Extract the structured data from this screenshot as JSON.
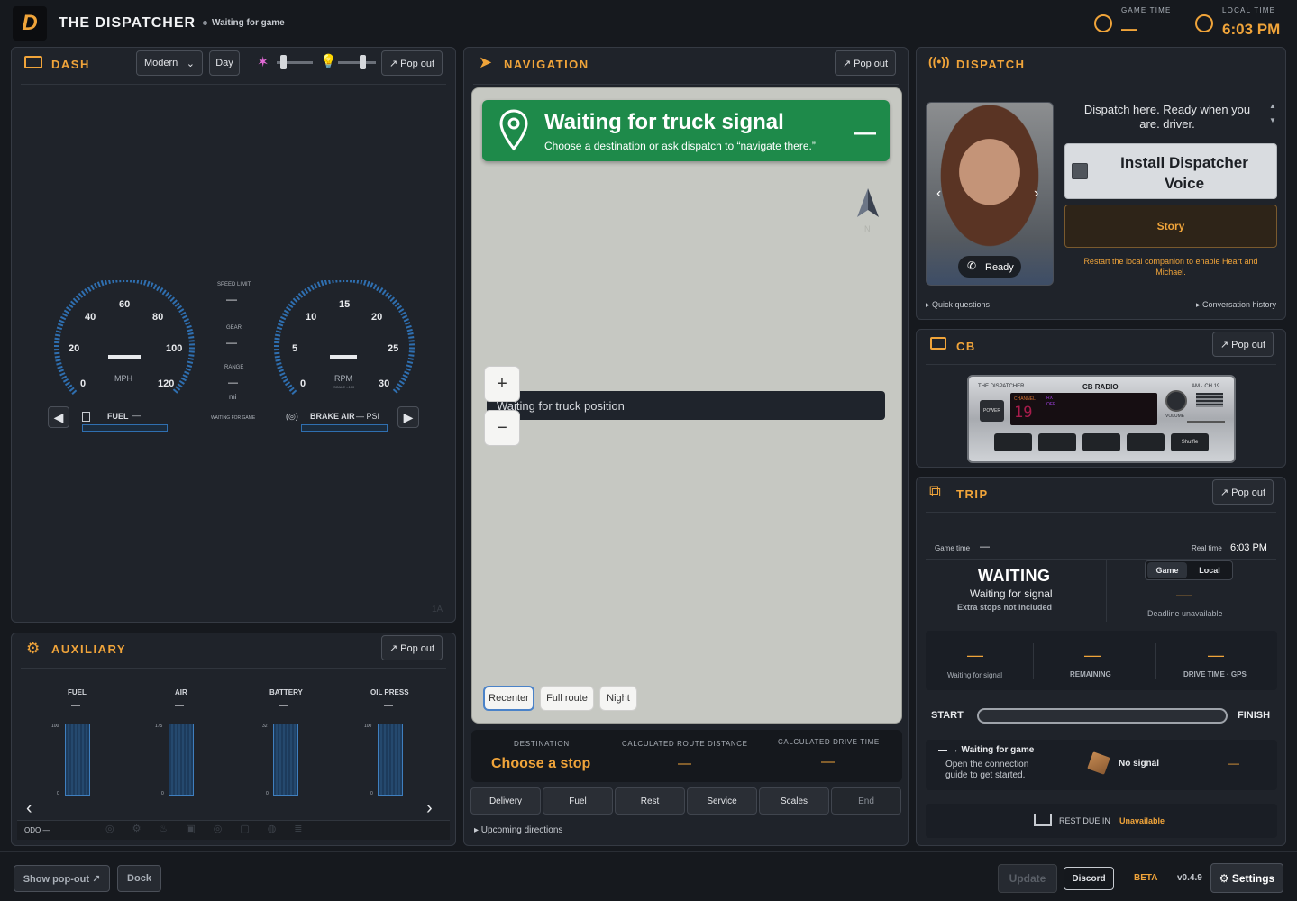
{
  "header": {
    "title": "THE DISPATCHER",
    "status": "Waiting for game",
    "game_time_label": "GAME TIME",
    "game_time_value": "—",
    "local_time_label": "LOCAL TIME",
    "local_time_value": "6:03 PM",
    "logo": "D"
  },
  "dash": {
    "title": "DASH",
    "style_select": "Modern",
    "day_button": "Day",
    "popout": "↗ Pop out",
    "speed_ticks": [
      "0",
      "20",
      "40",
      "60",
      "80",
      "100",
      "120"
    ],
    "speed_unit": "MPH",
    "rpm_ticks": [
      "0",
      "5",
      "10",
      "15",
      "20",
      "25",
      "30"
    ],
    "rpm_unit": "RPM",
    "rpm_scale": "SCALE ×100",
    "speed_value": "—",
    "rpm_value": "—",
    "speed_limit_label": "SPEED LIMIT",
    "speed_limit_value": "—",
    "gear_label": "GEAR",
    "gear_value": "—",
    "range_label": "RANGE",
    "range_value": "—",
    "range_unit": "mi",
    "waiting_label": "WAITING FOR GAME",
    "fuel_label": "FUEL",
    "fuel_value": "—",
    "brake_label": "BRAKE AIR",
    "brake_value": "— PSI",
    "corner": "1A"
  },
  "aux": {
    "title": "AUXILIARY",
    "popout": "↗ Pop out",
    "gauges": [
      {
        "label": "FUEL",
        "value": "—",
        "max": "100",
        "min": "0"
      },
      {
        "label": "AIR",
        "value": "—",
        "max": "175",
        "min": "0"
      },
      {
        "label": "BATTERY",
        "value": "—",
        "max": "32",
        "min": "0"
      },
      {
        "label": "OIL PRESS",
        "value": "—",
        "max": "100",
        "min": "0"
      }
    ],
    "odo": "ODO —"
  },
  "nav": {
    "title": "NAVIGATION",
    "popout": "↗ Pop out",
    "banner_title": "Waiting for truck signal",
    "banner_sub": "Choose a destination or ask dispatch to “navigate there.”",
    "banner_dash": "—",
    "waiting_position": "Waiting for truck position",
    "zoom_in": "+",
    "zoom_out": "−",
    "compass": "N",
    "recenter": "Recenter",
    "full_route": "Full route",
    "night": "Night",
    "dest_label": "DESTINATION",
    "dest_value": "Choose a stop",
    "dist_label": "CALCULATED ROUTE DISTANCE",
    "dist_value": "—",
    "drive_label": "CALCULATED DRIVE TIME",
    "drive_value": "—",
    "stops": [
      "Delivery",
      "Fuel",
      "Rest",
      "Service",
      "Scales",
      "End"
    ],
    "upcoming": "▸ Upcoming directions"
  },
  "dispatch": {
    "title": "DISPATCH",
    "message": "Dispatch here. Ready when you are, driver.",
    "install_label": "Install Dispatcher Voice",
    "story_label": "Story",
    "restart_note": "Restart the local companion to enable Heart and Michael.",
    "ready": "Ready",
    "quick": "▸ Quick questions",
    "history": "▸ Conversation history"
  },
  "cb": {
    "title": "CB",
    "popout": "↗ Pop out",
    "brand": "THE DISPATCHER",
    "radio": "CB RADIO",
    "band": "AM · CH 19",
    "power": "POWER",
    "channel_label": "CHANNEL",
    "channel": "19",
    "rx": "RX",
    "off": "OFF",
    "volume": "VOLUME",
    "shuffle": "Shuffle"
  },
  "trip": {
    "title": "TRIP",
    "popout": "↗ Pop out",
    "game_time_label": "Game time",
    "game_time_value": "—",
    "real_time_label": "Real time",
    "real_time_value": "6:03 PM",
    "status": "WAITING",
    "status_sub": "Waiting for signal",
    "status_note": "Extra stops not included",
    "toggle_game": "Game",
    "toggle_local": "Local",
    "deadline_value": "—",
    "deadline": "Deadline unavailable",
    "stat1_value": "—",
    "stat1_label": "Waiting for signal",
    "stat2_value": "—",
    "stat2_label": "REMAINING",
    "stat3_value": "—",
    "stat3_label": "DRIVE TIME · GPS",
    "start": "START",
    "finish": "FINISH",
    "wait_title": "— → Waiting for game",
    "wait_sub": "Open the connection guide to get started.",
    "no_signal": "No signal",
    "no_signal_dash": "—",
    "rest_label": "REST DUE IN",
    "rest_value": "Unavailable"
  },
  "footer": {
    "show_popout": "Show pop-out ↗",
    "dock": "Dock",
    "update": "Update",
    "discord": "Discord",
    "beta": "BETA",
    "version": "v0.4.9",
    "settings": "⚙ Settings"
  },
  "colors": {
    "accent": "#f0a43a",
    "nav_green": "#1e8a4a",
    "map_bg": "#c6c8c2"
  }
}
